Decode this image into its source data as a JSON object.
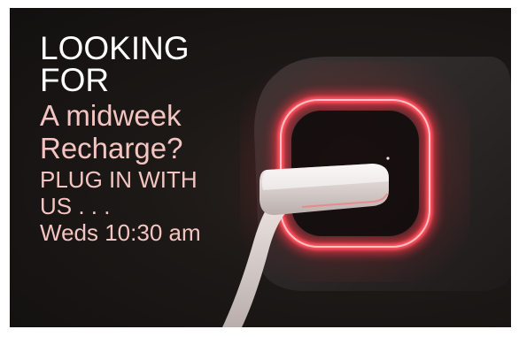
{
  "poster": {
    "line1": "LOOKING",
    "line2": "FOR",
    "line3": "A midweek",
    "line4": "Recharge?",
    "line5": "PLUG IN WITH",
    "line6": "US . . .",
    "line7": "Weds 10:30 am"
  },
  "colors": {
    "headline_white": "#ffffff",
    "headline_pink": "#f3c4c0",
    "charger_glow": "#ff4a55",
    "background": "#1a1614"
  },
  "photo": {
    "subject": "charger-with-glowing-ring-icon"
  }
}
